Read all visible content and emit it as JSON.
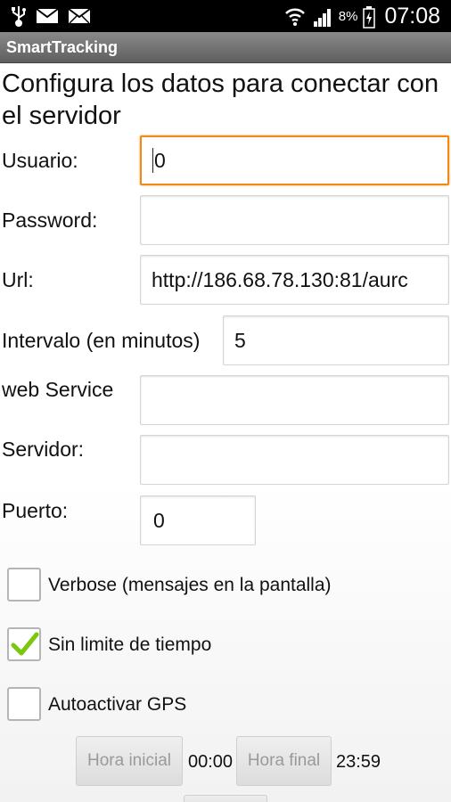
{
  "status_bar": {
    "battery_percent": "8%",
    "clock": "07:08",
    "icons": [
      "usb-icon",
      "email-icon",
      "mail-icon",
      "wifi-icon",
      "signal-icon",
      "battery-charging-icon"
    ]
  },
  "app": {
    "title": "SmartTracking"
  },
  "form": {
    "heading": "Configura los datos para conectar con el servidor",
    "usuario": {
      "label": "Usuario:",
      "value": "0"
    },
    "password": {
      "label": "Password:",
      "value": ""
    },
    "url": {
      "label": "Url:",
      "value": "http://186.68.78.130:81/aurc"
    },
    "intervalo": {
      "label": "Intervalo (en minutos)",
      "value": "5"
    },
    "web_service": {
      "label": "web Service",
      "value": ""
    },
    "servidor": {
      "label": "Servidor:",
      "value": ""
    },
    "puerto": {
      "label": "Puerto:",
      "value": "0"
    }
  },
  "options": {
    "verbose": {
      "label": "Verbose (mensajes en la pantalla)",
      "checked": false
    },
    "sin_limite": {
      "label": "Sin limite de tiempo",
      "checked": true
    },
    "autoactivar": {
      "label": "Autoactivar GPS",
      "checked": false
    }
  },
  "time": {
    "start_button": "Hora inicial",
    "start_value": "00:00",
    "end_button": "Hora final",
    "end_value": "23:59"
  },
  "colors": {
    "focus_accent": "#f0891a",
    "check_green": "#7ac70c",
    "title_bar": "#6e6e6e"
  }
}
